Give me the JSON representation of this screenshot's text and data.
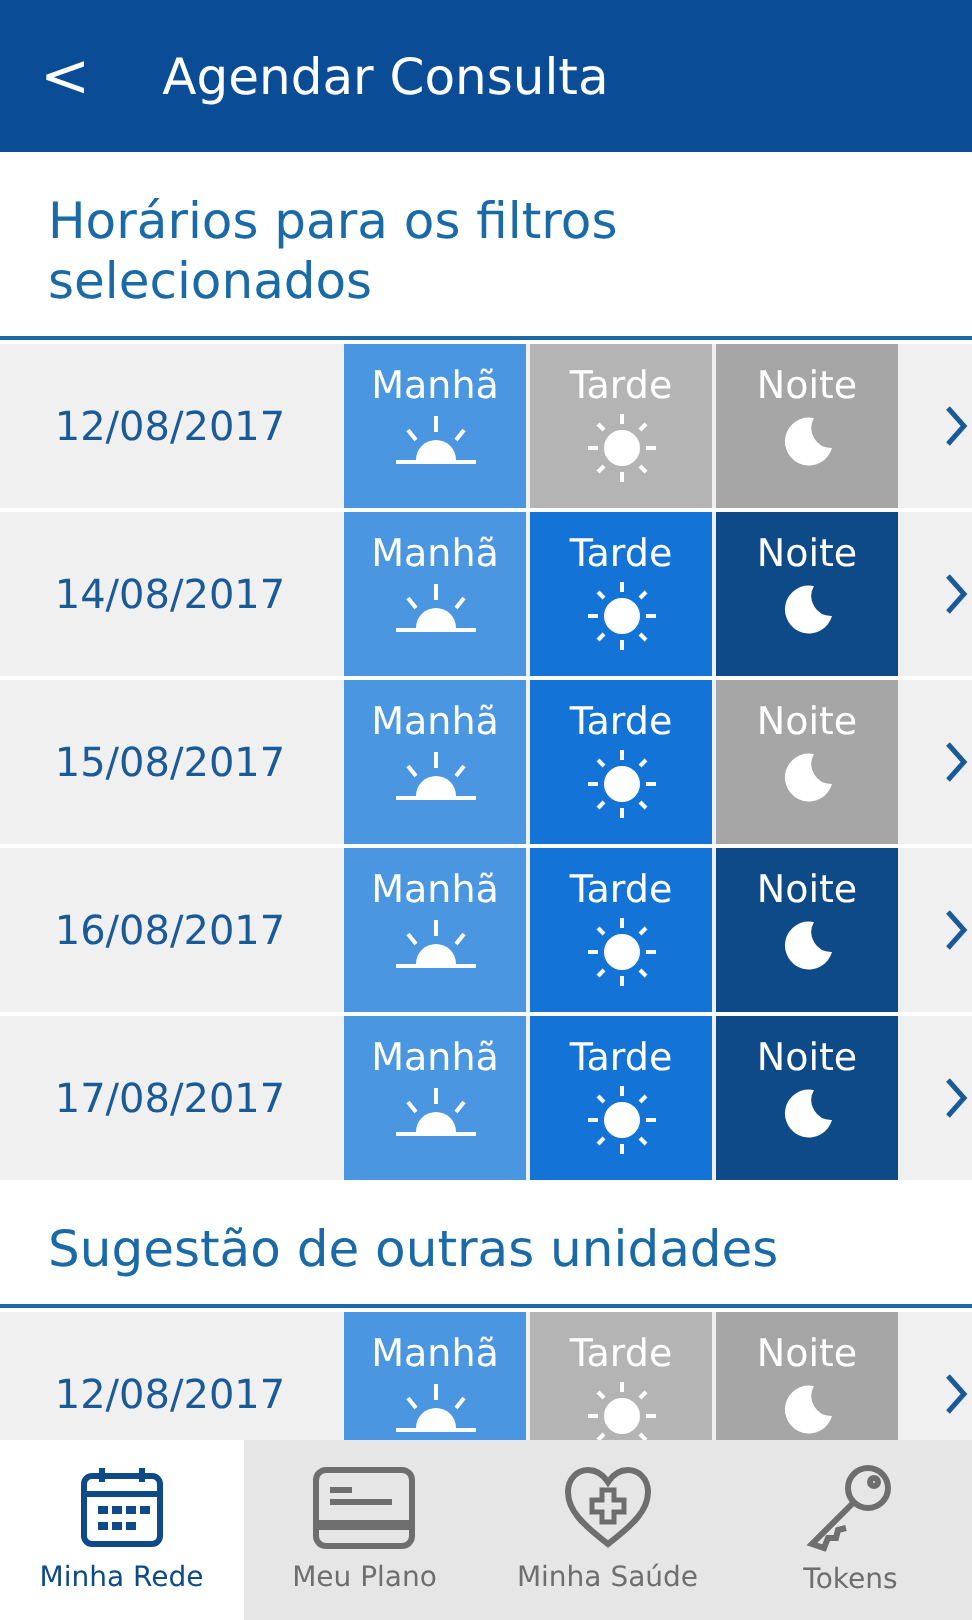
{
  "header": {
    "back": "<",
    "title": "Agendar Consulta"
  },
  "sections": [
    {
      "title": "Horários para os filtros selecionados",
      "rows": [
        {
          "date": "12/08/2017",
          "slots": [
            {
              "kind": "morning",
              "label": "Manhã",
              "available": true
            },
            {
              "kind": "afternoon",
              "label": "Tarde",
              "available": false
            },
            {
              "kind": "night",
              "label": "Noite",
              "available": false
            }
          ]
        },
        {
          "date": "14/08/2017",
          "slots": [
            {
              "kind": "morning",
              "label": "Manhã",
              "available": true
            },
            {
              "kind": "afternoon",
              "label": "Tarde",
              "available": true
            },
            {
              "kind": "night",
              "label": "Noite",
              "available": true
            }
          ]
        },
        {
          "date": "15/08/2017",
          "slots": [
            {
              "kind": "morning",
              "label": "Manhã",
              "available": true
            },
            {
              "kind": "afternoon",
              "label": "Tarde",
              "available": true
            },
            {
              "kind": "night",
              "label": "Noite",
              "available": false
            }
          ]
        },
        {
          "date": "16/08/2017",
          "slots": [
            {
              "kind": "morning",
              "label": "Manhã",
              "available": true
            },
            {
              "kind": "afternoon",
              "label": "Tarde",
              "available": true
            },
            {
              "kind": "night",
              "label": "Noite",
              "available": true
            }
          ]
        },
        {
          "date": "17/08/2017",
          "slots": [
            {
              "kind": "morning",
              "label": "Manhã",
              "available": true
            },
            {
              "kind": "afternoon",
              "label": "Tarde",
              "available": true
            },
            {
              "kind": "night",
              "label": "Noite",
              "available": true
            }
          ]
        }
      ]
    },
    {
      "title": "Sugestão de outras unidades",
      "rows": [
        {
          "date": "12/08/2017",
          "slots": [
            {
              "kind": "morning",
              "label": "Manhã",
              "available": true
            },
            {
              "kind": "afternoon",
              "label": "Tarde",
              "available": false
            },
            {
              "kind": "night",
              "label": "Noite",
              "available": false
            }
          ]
        }
      ]
    }
  ],
  "nav": [
    {
      "kind": "calendar",
      "label": "Minha Rede",
      "selected": true
    },
    {
      "kind": "card",
      "label": "Meu Plano",
      "selected": false
    },
    {
      "kind": "health",
      "label": "Minha Saúde",
      "selected": false
    },
    {
      "kind": "key",
      "label": "Tokens",
      "selected": false
    }
  ]
}
